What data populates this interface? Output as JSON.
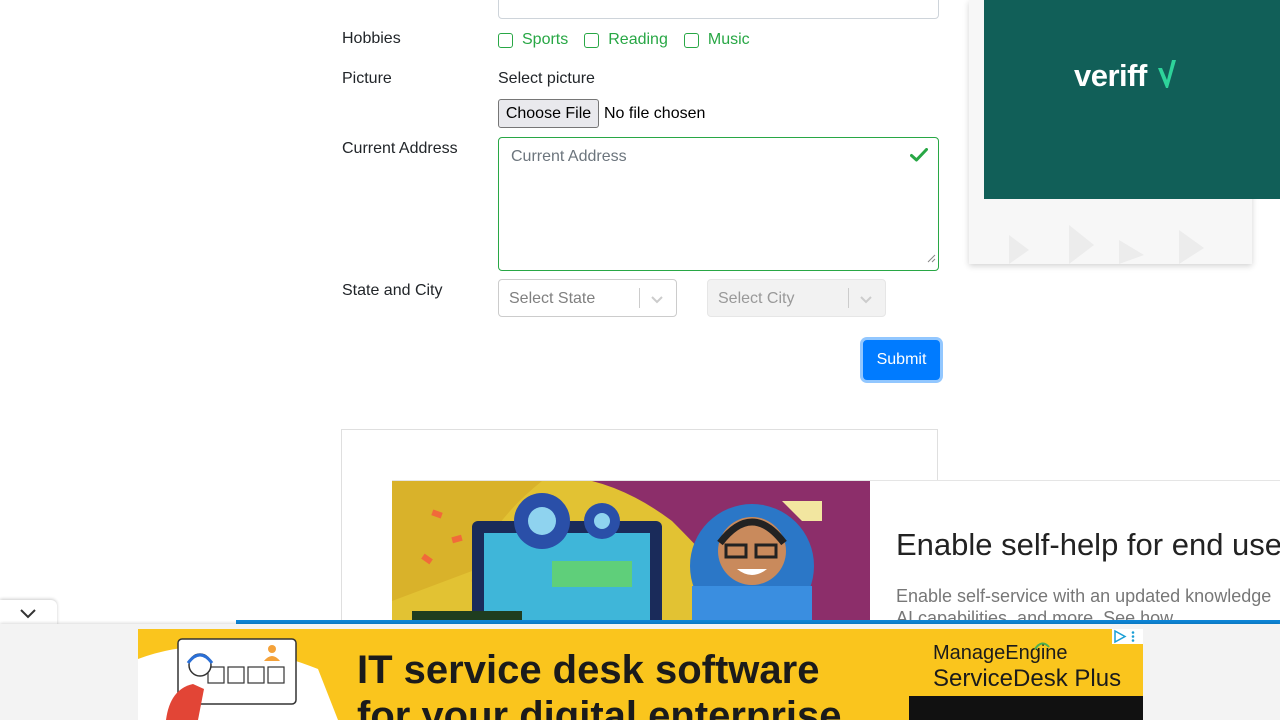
{
  "form": {
    "hobbies_label": "Hobbies",
    "hobbies": [
      {
        "label": "Sports",
        "checked": false
      },
      {
        "label": "Reading",
        "checked": false
      },
      {
        "label": "Music",
        "checked": false
      }
    ],
    "picture_label": "Picture",
    "picture_caption": "Select picture",
    "file_button": "Choose File",
    "file_status": "No file chosen",
    "address_label": "Current Address",
    "address_placeholder": "Current Address",
    "state_city_label": "State and City",
    "state_placeholder": "Select State",
    "city_placeholder": "Select City",
    "submit_label": "Submit"
  },
  "side_ad": {
    "brand": "veriff",
    "bg_color": "#115f58"
  },
  "inline_ad": {
    "headline": "Enable self-help for end user",
    "body_line1": "Enable self-service with an updated knowledge",
    "body_line2": "AI capabilities, and more. See how."
  },
  "bottom_banner": {
    "headline_line1": "IT service desk software",
    "headline_line2": "for your digital enterprise",
    "brand": "ManageEngine",
    "product": "ServiceDesk Plus",
    "bg_color": "#fac51d"
  },
  "colors": {
    "success": "#28a745",
    "primary": "#007bff"
  }
}
